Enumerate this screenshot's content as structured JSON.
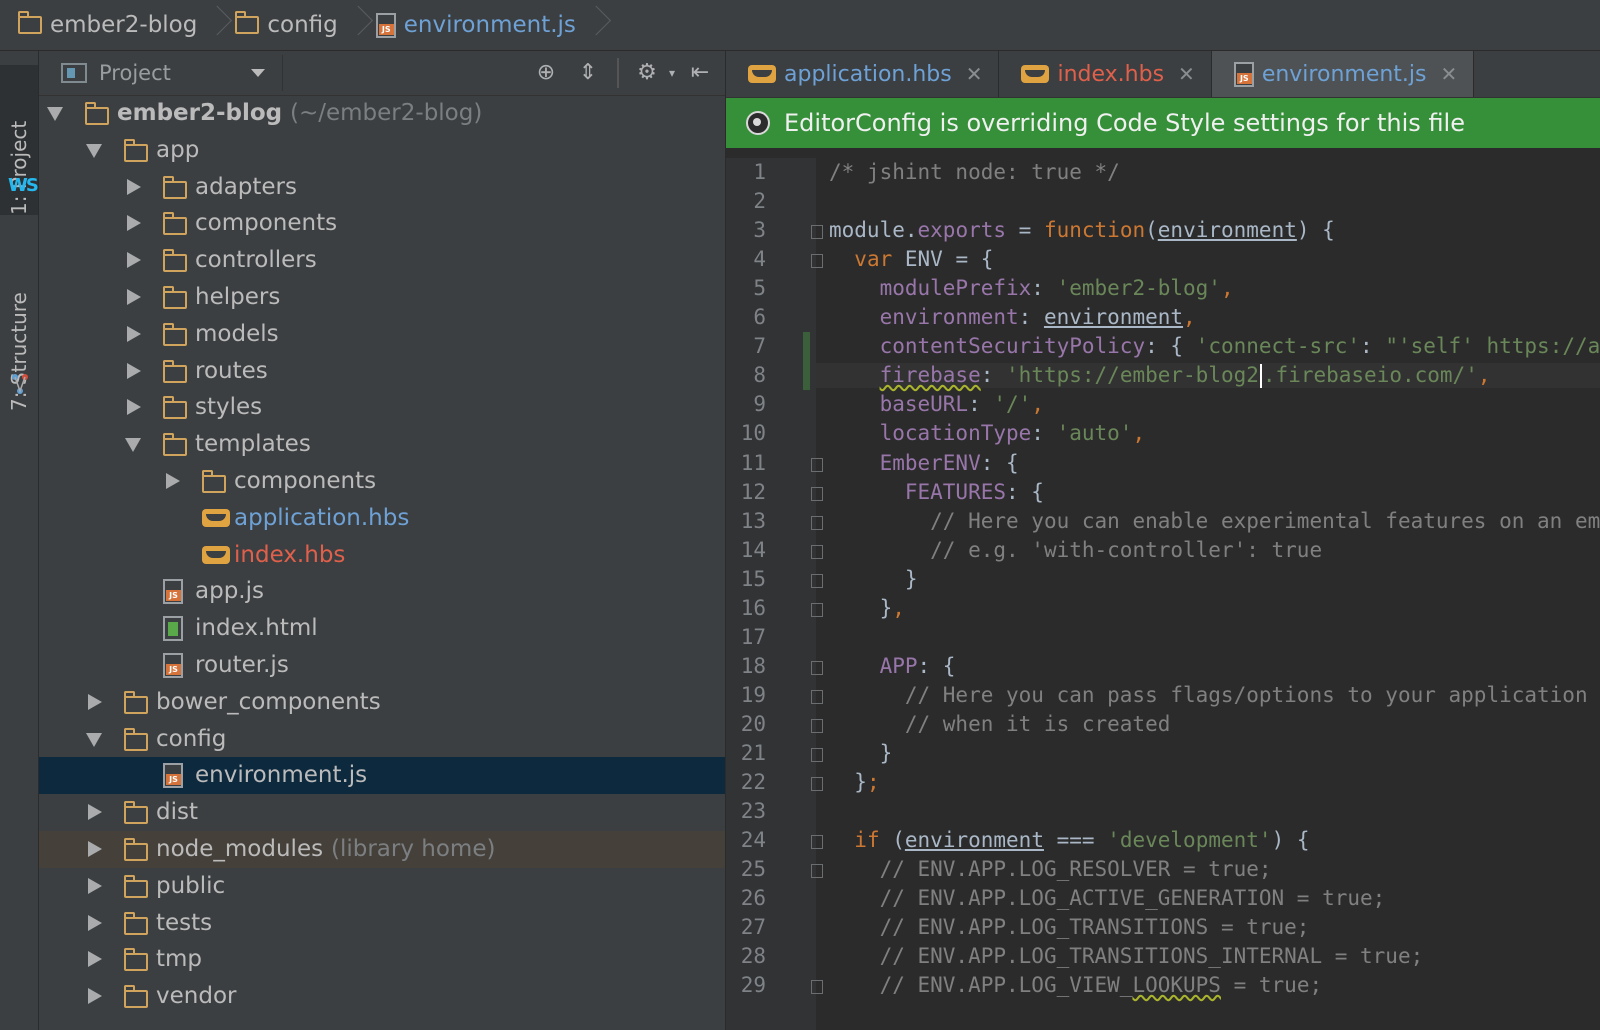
{
  "breadcrumb": {
    "items": [
      {
        "label": "ember2-blog",
        "icon": "folder-icon"
      },
      {
        "label": "config",
        "icon": "folder-icon"
      },
      {
        "label": "environment.js",
        "icon": "js-file-icon"
      }
    ]
  },
  "tool_strip": {
    "project_label": "1: Project",
    "structure_label": "7: Structure",
    "logo_text": "WS"
  },
  "project_panel": {
    "title": "Project",
    "tree": [
      {
        "label": "ember2-blog",
        "suffix": "(~/ember2-blog)",
        "depth": 0,
        "type": "folder",
        "state": "expanded"
      },
      {
        "label": "app",
        "depth": 1,
        "type": "folder",
        "state": "expanded"
      },
      {
        "label": "adapters",
        "depth": 2,
        "type": "folder",
        "state": "collapsed"
      },
      {
        "label": "components",
        "depth": 2,
        "type": "folder",
        "state": "collapsed"
      },
      {
        "label": "controllers",
        "depth": 2,
        "type": "folder",
        "state": "collapsed"
      },
      {
        "label": "helpers",
        "depth": 2,
        "type": "folder",
        "state": "collapsed"
      },
      {
        "label": "models",
        "depth": 2,
        "type": "folder",
        "state": "collapsed"
      },
      {
        "label": "routes",
        "depth": 2,
        "type": "folder",
        "state": "collapsed"
      },
      {
        "label": "styles",
        "depth": 2,
        "type": "folder",
        "state": "collapsed"
      },
      {
        "label": "templates",
        "depth": 2,
        "type": "folder",
        "state": "expanded"
      },
      {
        "label": "components",
        "depth": 3,
        "type": "folder",
        "state": "collapsed"
      },
      {
        "label": "application.hbs",
        "depth": 3,
        "type": "hbs",
        "color": "#6ea1d5"
      },
      {
        "label": "index.hbs",
        "depth": 3,
        "type": "hbs",
        "color": "#e0604b"
      },
      {
        "label": "app.js",
        "depth": 2,
        "type": "js"
      },
      {
        "label": "index.html",
        "depth": 2,
        "type": "html"
      },
      {
        "label": "router.js",
        "depth": 2,
        "type": "js"
      },
      {
        "label": "bower_components",
        "depth": 1,
        "type": "folder",
        "state": "collapsed"
      },
      {
        "label": "config",
        "depth": 1,
        "type": "folder",
        "state": "expanded"
      },
      {
        "label": "environment.js",
        "depth": 2,
        "type": "js",
        "selected": true
      },
      {
        "label": "dist",
        "depth": 1,
        "type": "folder",
        "state": "collapsed"
      },
      {
        "label": "node_modules",
        "suffix": "(library home)",
        "depth": 1,
        "type": "folder",
        "state": "collapsed",
        "excluded": true
      },
      {
        "label": "public",
        "depth": 1,
        "type": "folder",
        "state": "collapsed"
      },
      {
        "label": "tests",
        "depth": 1,
        "type": "folder",
        "state": "collapsed"
      },
      {
        "label": "tmp",
        "depth": 1,
        "type": "folder",
        "state": "collapsed"
      },
      {
        "label": "vendor",
        "depth": 1,
        "type": "folder",
        "state": "collapsed"
      }
    ]
  },
  "editor": {
    "tabs": [
      {
        "label": "application.hbs",
        "icon": "hbs",
        "color": "#6ea1d5"
      },
      {
        "label": "index.hbs",
        "icon": "hbs",
        "color": "#e0604b"
      },
      {
        "label": "environment.js",
        "icon": "js",
        "color": "#6ea1d5",
        "active": true
      }
    ],
    "notification": "EditorConfig is overriding Code Style settings for this file",
    "lines": [
      {
        "n": "1",
        "tokens": [
          [
            "c-cm",
            "/* jshint node: true */"
          ]
        ]
      },
      {
        "n": "2",
        "tokens": []
      },
      {
        "n": "3",
        "tokens": [
          [
            "",
            "module."
          ],
          [
            "c-pr",
            "exports"
          ],
          [
            "",
            " = "
          ],
          [
            "c-kw",
            "function"
          ],
          [
            "",
            "("
          ],
          [
            "c-un",
            "environment"
          ],
          [
            "",
            ") {"
          ]
        ]
      },
      {
        "n": "4",
        "tokens": [
          [
            "",
            "  "
          ],
          [
            "c-kw",
            "var"
          ],
          [
            "",
            " ENV = {"
          ]
        ]
      },
      {
        "n": "5",
        "tokens": [
          [
            "",
            "    "
          ],
          [
            "c-pr",
            "modulePrefix"
          ],
          [
            "",
            ": "
          ],
          [
            "c-st",
            "'ember2-blog'"
          ],
          [
            "c-kw",
            ","
          ]
        ]
      },
      {
        "n": "6",
        "tokens": [
          [
            "",
            "    "
          ],
          [
            "c-pr",
            "environment"
          ],
          [
            "",
            ": "
          ],
          [
            "c-un",
            "environment"
          ],
          [
            "c-kw",
            ","
          ]
        ]
      },
      {
        "n": "7",
        "tokens": [
          [
            "",
            "    "
          ],
          [
            "c-pr",
            "contentSecurityPolicy"
          ],
          [
            "",
            ": { "
          ],
          [
            "c-st",
            "'connect-src'"
          ],
          [
            "",
            ": "
          ],
          [
            "c-st",
            "\"'self' https://auth.firebase.com"
          ]
        ]
      },
      {
        "n": "8",
        "caret": true,
        "tokens": [
          [
            "",
            "    "
          ],
          [
            "c-pr c-sq",
            "firebase"
          ],
          [
            "",
            ": "
          ],
          [
            "c-st",
            "'https://ember-blog2"
          ],
          [
            "caret",
            ""
          ],
          [
            "c-st",
            ".firebaseio.com/'"
          ],
          [
            "c-kw",
            ","
          ]
        ]
      },
      {
        "n": "9",
        "tokens": [
          [
            "",
            "    "
          ],
          [
            "c-pr",
            "baseURL"
          ],
          [
            "",
            ": "
          ],
          [
            "c-st",
            "'/'"
          ],
          [
            "c-kw",
            ","
          ]
        ]
      },
      {
        "n": "10",
        "tokens": [
          [
            "",
            "    "
          ],
          [
            "c-pr",
            "locationType"
          ],
          [
            "",
            ": "
          ],
          [
            "c-st",
            "'auto'"
          ],
          [
            "c-kw",
            ","
          ]
        ]
      },
      {
        "n": "11",
        "tokens": [
          [
            "",
            "    "
          ],
          [
            "c-pr",
            "EmberENV"
          ],
          [
            "",
            ": {"
          ]
        ]
      },
      {
        "n": "12",
        "tokens": [
          [
            "",
            "      "
          ],
          [
            "c-pr",
            "FEATURES"
          ],
          [
            "",
            ": {"
          ]
        ]
      },
      {
        "n": "13",
        "tokens": [
          [
            "",
            "        "
          ],
          [
            "c-cm",
            "// Here you can enable experimental features on an ember canary build"
          ]
        ]
      },
      {
        "n": "14",
        "tokens": [
          [
            "",
            "        "
          ],
          [
            "c-cm",
            "// e.g. 'with-controller': true"
          ]
        ]
      },
      {
        "n": "15",
        "tokens": [
          [
            "",
            "      }"
          ]
        ]
      },
      {
        "n": "16",
        "tokens": [
          [
            "",
            "    }"
          ],
          [
            "c-kw",
            ","
          ]
        ]
      },
      {
        "n": "17",
        "tokens": []
      },
      {
        "n": "18",
        "tokens": [
          [
            "",
            "    "
          ],
          [
            "c-pr",
            "APP"
          ],
          [
            "",
            ": {"
          ]
        ]
      },
      {
        "n": "19",
        "tokens": [
          [
            "",
            "      "
          ],
          [
            "c-cm",
            "// Here you can pass flags/options to your application instance"
          ]
        ]
      },
      {
        "n": "20",
        "tokens": [
          [
            "",
            "      "
          ],
          [
            "c-cm",
            "// when it is created"
          ]
        ]
      },
      {
        "n": "21",
        "tokens": [
          [
            "",
            "    }"
          ]
        ]
      },
      {
        "n": "22",
        "tokens": [
          [
            "",
            "  }"
          ],
          [
            "c-kw",
            ";"
          ]
        ]
      },
      {
        "n": "23",
        "tokens": []
      },
      {
        "n": "24",
        "tokens": [
          [
            "",
            "  "
          ],
          [
            "c-kw",
            "if"
          ],
          [
            "",
            " ("
          ],
          [
            "c-un",
            "environment"
          ],
          [
            "",
            " === "
          ],
          [
            "c-st",
            "'development'"
          ],
          [
            "",
            ") {"
          ]
        ]
      },
      {
        "n": "25",
        "tokens": [
          [
            "",
            "    "
          ],
          [
            "c-cm",
            "// ENV.APP.LOG_RESOLVER = true;"
          ]
        ]
      },
      {
        "n": "26",
        "tokens": [
          [
            "",
            "    "
          ],
          [
            "c-cm",
            "// ENV.APP.LOG_ACTIVE_GENERATION = true;"
          ]
        ]
      },
      {
        "n": "27",
        "tokens": [
          [
            "",
            "    "
          ],
          [
            "c-cm",
            "// ENV.APP.LOG_TRANSITIONS = true;"
          ]
        ]
      },
      {
        "n": "28",
        "tokens": [
          [
            "",
            "    "
          ],
          [
            "c-cm",
            "// ENV.APP.LOG_TRANSITIONS_INTERNAL = true;"
          ]
        ]
      },
      {
        "n": "29",
        "tokens": [
          [
            "",
            "    "
          ],
          [
            "c-cm",
            "// ENV.APP.LOG_VIEW_"
          ],
          [
            "c-cm c-sq",
            "LOOKUPS"
          ],
          [
            "c-cm",
            " = true;"
          ]
        ]
      }
    ],
    "folds": [
      "3",
      "4",
      "11",
      "12",
      "13",
      "14",
      "15",
      "16",
      "18",
      "19",
      "20",
      "21",
      "22",
      "24",
      "25",
      "29"
    ],
    "changed_lines": [
      "7",
      "8"
    ]
  }
}
